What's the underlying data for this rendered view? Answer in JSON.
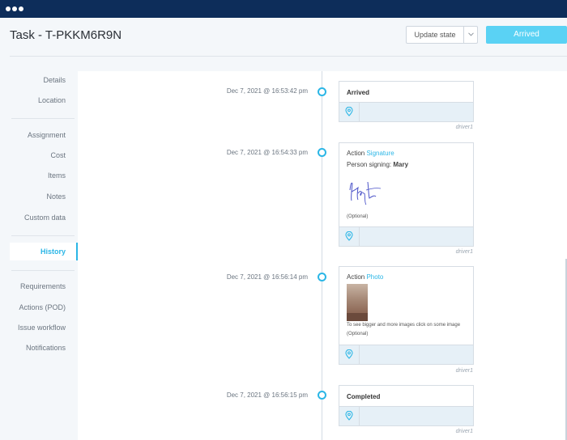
{
  "task": {
    "title": "Task - T-PKKM6R9N"
  },
  "header": {
    "update_state_label": "Update state",
    "status_label": "Arrived"
  },
  "nav": [
    {
      "label": "Details"
    },
    {
      "label": "Location"
    },
    {
      "label": "Assignment"
    },
    {
      "label": "Cost"
    },
    {
      "label": "Items"
    },
    {
      "label": "Notes"
    },
    {
      "label": "Custom data"
    },
    {
      "label": "History"
    },
    {
      "label": "Requirements"
    },
    {
      "label": "Actions (POD)"
    },
    {
      "label": "Issue workflow"
    },
    {
      "label": "Notifications"
    }
  ],
  "active_nav": "History",
  "history": [
    {
      "timestamp": "Dec 7, 2021 @ 16:53:42 pm",
      "title": "Arrived",
      "driver": "driver1"
    },
    {
      "timestamp": "Dec 7, 2021 @ 16:54:33 pm",
      "action_prefix": "Action",
      "action_name": "Signature",
      "signer_prefix": "Person signing:",
      "signer_name": "Mary",
      "note": "(Optional)",
      "driver": "driver1"
    },
    {
      "timestamp": "Dec 7, 2021 @ 16:56:14 pm",
      "action_prefix": "Action",
      "action_name": "Photo",
      "hint": "To see bigger and more images click on some image",
      "note": "(Optional)",
      "driver": "driver1"
    },
    {
      "timestamp": "Dec 7, 2021 @ 16:56:15 pm",
      "title": "Completed",
      "driver": "driver1"
    }
  ],
  "colors": {
    "titlebar": "#0d2d5a",
    "accent": "#2bb6e6",
    "status_button": "#5ad2f4",
    "footer_bg": "#e6f0f7"
  },
  "icons": {
    "location": "map-pin-icon",
    "dropdown": "chevron-down-icon",
    "timeline_node": "circle-node-icon"
  }
}
